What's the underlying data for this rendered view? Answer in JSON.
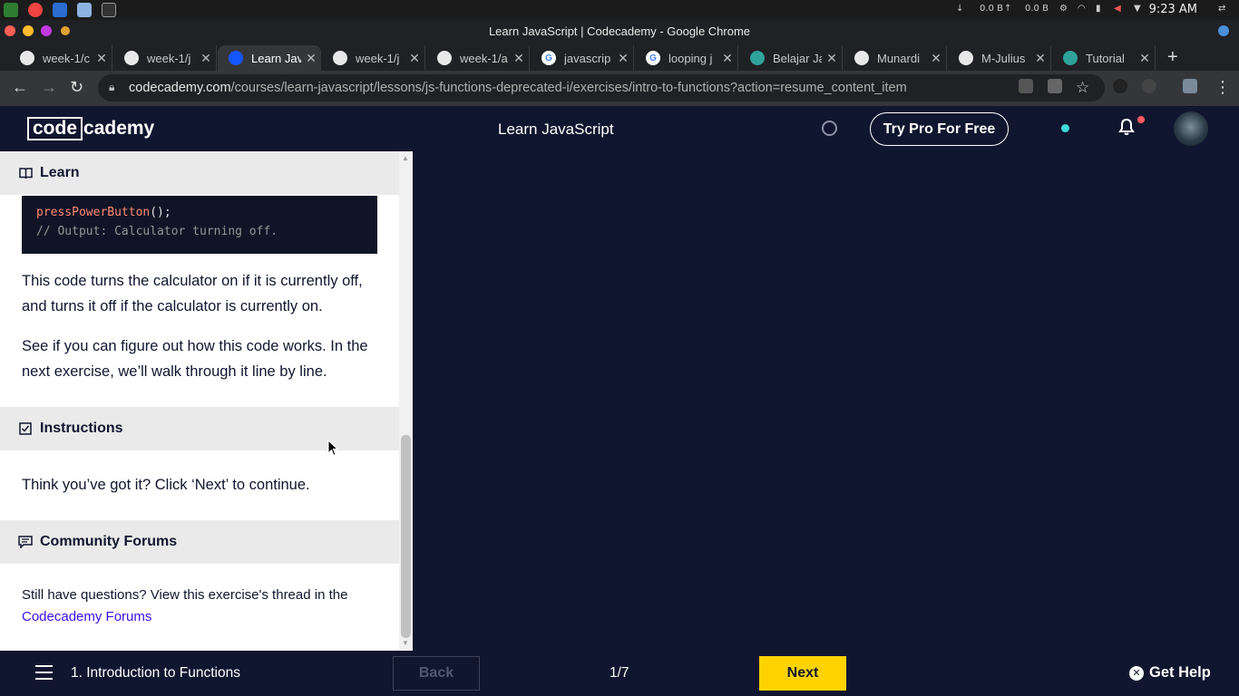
{
  "system": {
    "net_down": "0.0 B",
    "net_up": "0.0 B",
    "clock": "9:23 AM"
  },
  "window": {
    "title": "Learn JavaScript | Codecademy - Google Chrome"
  },
  "tabs": [
    {
      "label": "week-1/c",
      "favicon": "github-icon"
    },
    {
      "label": "week-1/j",
      "favicon": "github-icon"
    },
    {
      "label": "Learn Jav",
      "favicon": "codecademy-icon",
      "active": true
    },
    {
      "label": "week-1/j",
      "favicon": "github-icon"
    },
    {
      "label": "week-1/a",
      "favicon": "github-icon"
    },
    {
      "label": "javascrip",
      "favicon": "google-icon"
    },
    {
      "label": "looping j",
      "favicon": "google-icon"
    },
    {
      "label": "Belajar Ja",
      "favicon": "site-icon"
    },
    {
      "label": "Munardi",
      "favicon": "github-icon"
    },
    {
      "label": "M-Julius",
      "favicon": "github-icon"
    },
    {
      "label": "Tutorial",
      "favicon": "site-icon"
    }
  ],
  "address": {
    "host": "codecademy.com",
    "path": "/courses/learn-javascript/lessons/js-functions-deprecated-i/exercises/intro-to-functions?action=resume_content_item"
  },
  "header": {
    "logo_box": "code",
    "logo_rest": "cademy",
    "course_title": "Learn JavaScript",
    "try_pro": "Try Pro For Free"
  },
  "panel": {
    "learn_label": "Learn",
    "code_line1": "pressPowerButton",
    "code_line1_punct": "();",
    "code_line2": "// Output: Calculator turning off.",
    "para1": "This code turns the calculator on if it is currently off, and turns it off if the calculator is currently on.",
    "para2": "See if you can figure out how this code works. In the next exercise, we’ll walk through it line by line.",
    "instructions_label": "Instructions",
    "instructions_text": "Think you’ve got it? Click ‘Next’ to continue.",
    "forums_label": "Community Forums",
    "forums_text": "Still have questions? View this exercise's thread in the ",
    "forums_link": "Codecademy Forums"
  },
  "footer": {
    "lesson": "1. Introduction to Functions",
    "back": "Back",
    "progress": "1/7",
    "next": "Next",
    "get_help": "Get Help"
  },
  "colors": {
    "navy": "#10162f",
    "next_yellow": "#ffd300",
    "link": "#3a10e5",
    "code_fn": "#ff8973"
  }
}
